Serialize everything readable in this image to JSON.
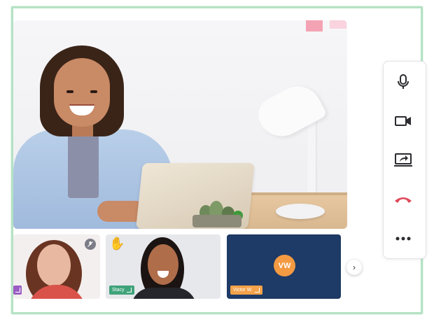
{
  "participants": [
    {
      "name": "",
      "muted": true,
      "tag_color": "#9b5cc4"
    },
    {
      "name": "Stacy",
      "raised_hand": "✋",
      "tag_color": "#3fa37a"
    },
    {
      "name": "Victor W.",
      "initials": "VW",
      "tag_color": "#f3a24a",
      "avatar_color": "#f39a42"
    }
  ],
  "controls": [
    {
      "icon": "microphone-icon"
    },
    {
      "icon": "video-camera-icon"
    },
    {
      "icon": "share-screen-icon"
    },
    {
      "icon": "hang-up-icon",
      "color": "#e0495a"
    },
    {
      "icon": "more-options-icon"
    }
  ],
  "colors": {
    "frame_border": "#b5e2c4",
    "hangup": "#e0495a",
    "vw_tile": "#1e3a66"
  }
}
